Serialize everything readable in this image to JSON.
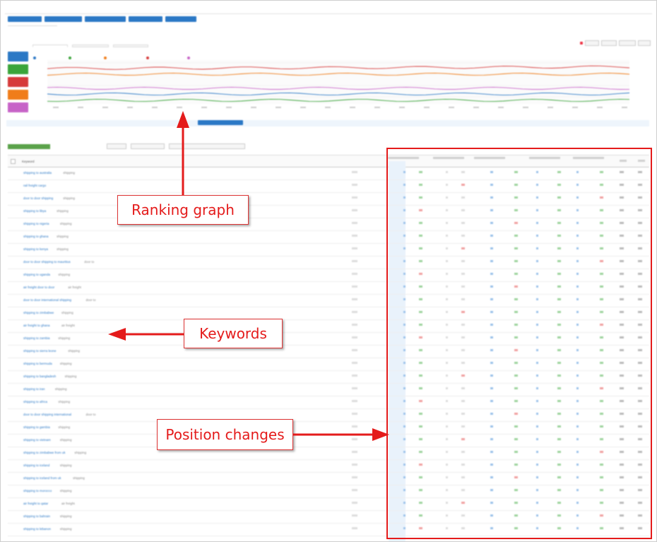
{
  "annotations": {
    "ranking_graph": "Ranking graph",
    "keywords": "Keywords",
    "position_changes": "Position changes"
  },
  "colors": {
    "accent_blue": "#2b78c5",
    "annotation_red": "#e41b1b",
    "badge_colors": [
      "#2b78c5",
      "#3aa43a",
      "#d63a3a",
      "#f07d1a",
      "#c763c7"
    ],
    "series_colors": [
      "#2b78c5",
      "#3aa43a",
      "#f07d1a",
      "#d63a3a",
      "#c763c7"
    ]
  },
  "table": {
    "keyword_header": "Keyword",
    "keyword_link_texts": [
      "shipping to australia",
      "rail freight cargo",
      "door to door shipping",
      "shipping to libya",
      "shipping to nigeria",
      "shipping to ghana",
      "shipping to kenya",
      "door to door shipping to mauritius",
      "shipping to uganda",
      "air freight door to door",
      "door to door international shipping",
      "shipping to zimbabwe",
      "air freight to ghana",
      "shipping to zambia",
      "shipping to sierra leone",
      "shipping to bermuda",
      "shipping to bangladesh",
      "shipping to iran",
      "shipping to africa",
      "door to door shipping international",
      "shipping to gambia",
      "shipping to vietnam",
      "shipping to zimbabwe from uk",
      "shipping to iceland",
      "shipping to iceland from uk",
      "shipping to morocco",
      "air freight to qatar",
      "shipping to bahrain",
      "shipping to lebanon"
    ],
    "keyword_tags": [
      "shipping",
      "",
      "shipping",
      "shipping",
      "shipping",
      "shipping",
      "shipping",
      "door to",
      "shipping",
      "air freight",
      "door to",
      "shipping",
      "air freight",
      "shipping",
      "shipping",
      "shipping",
      "shipping",
      "shipping",
      "shipping",
      "door to",
      "shipping",
      "shipping",
      "shipping",
      "shipping",
      "shipping",
      "shipping",
      "air freight",
      "shipping",
      "shipping"
    ]
  }
}
